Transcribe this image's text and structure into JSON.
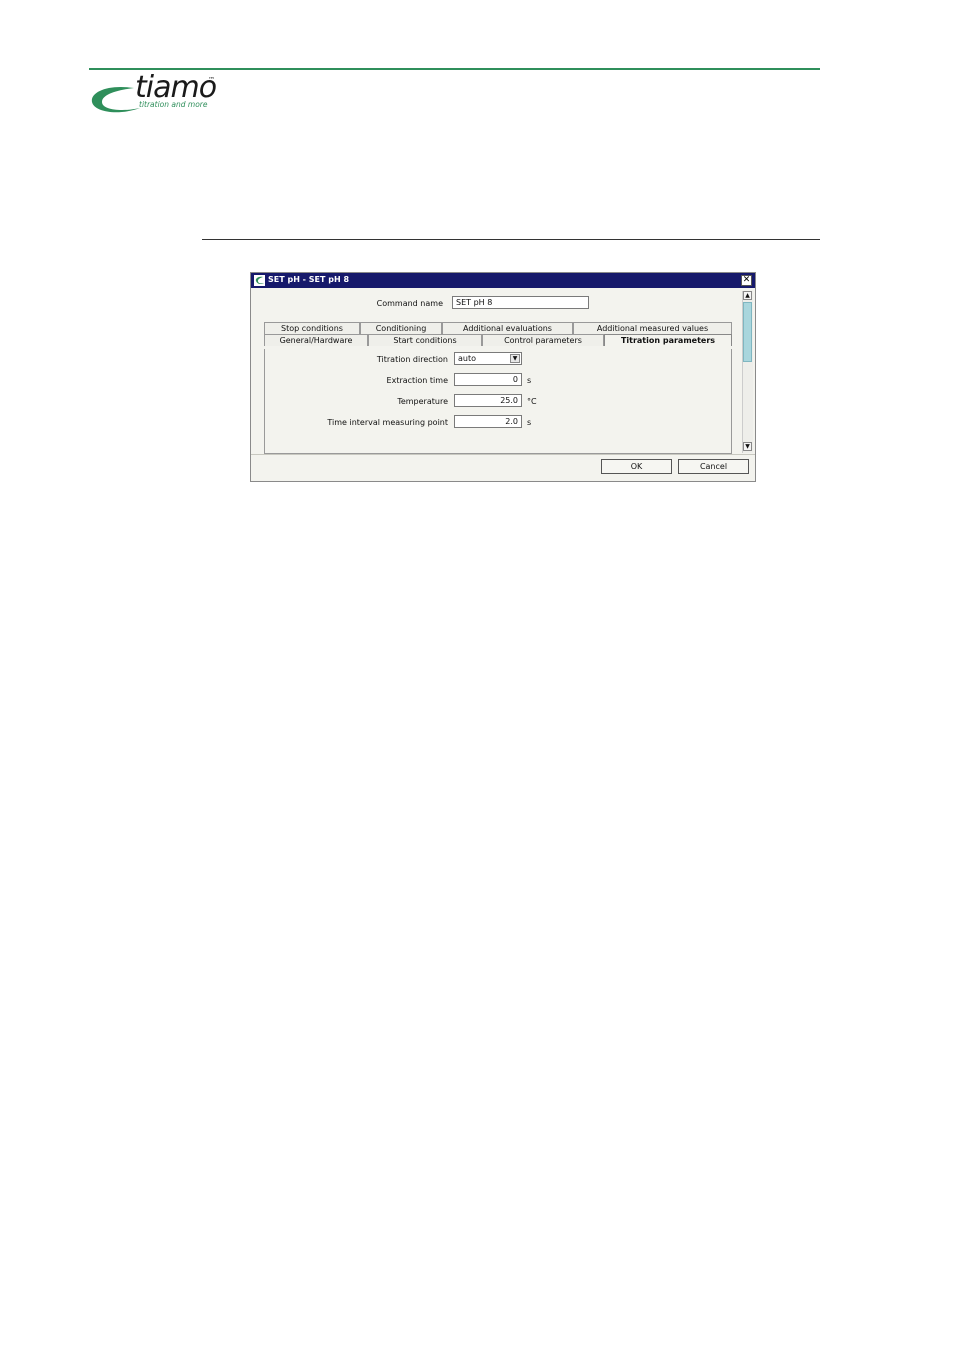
{
  "header": {
    "logo_text": "tiamo",
    "logo_tm": "™",
    "logo_tagline": "titration and more",
    "colors": {
      "brand_green": "#2f8f5b"
    }
  },
  "dialog": {
    "title": "SET pH - SET pH 8",
    "close_glyph": "✕",
    "command_name_label": "Command name",
    "command_name_value": "SET pH 8",
    "tabs_row1": [
      "Stop conditions",
      "Conditioning",
      "Additional evaluations",
      "Additional measured values"
    ],
    "tabs_row2": [
      "General/Hardware",
      "Start conditions",
      "Control parameters",
      "Titration parameters"
    ],
    "active_tab": "Titration parameters",
    "params": {
      "titration_direction_label": "Titration direction",
      "titration_direction_value": "auto",
      "extraction_time_label": "Extraction time",
      "extraction_time_value": "0",
      "extraction_time_unit": "s",
      "temperature_label": "Temperature",
      "temperature_value": "25.0",
      "temperature_unit": "°C",
      "time_interval_label": "Time interval measuring point",
      "time_interval_value": "2.0",
      "time_interval_unit": "s"
    },
    "buttons": {
      "ok": "OK",
      "cancel": "Cancel"
    },
    "colors": {
      "titlebar": "#16196b",
      "scroll_thumb": "#a9d6dd"
    }
  }
}
